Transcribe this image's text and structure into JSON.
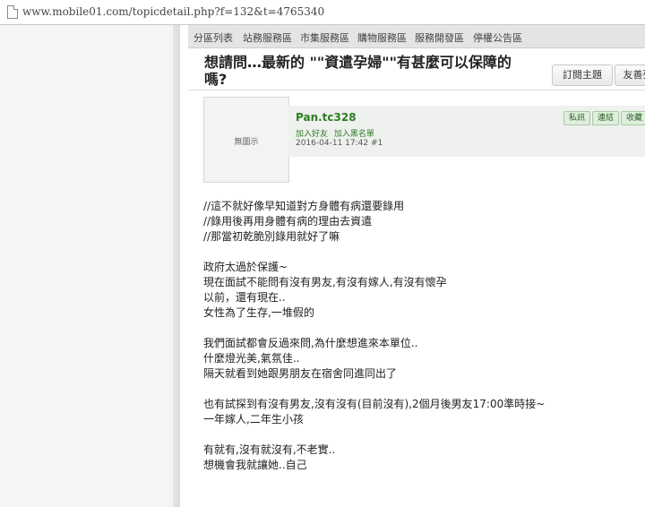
{
  "browser": {
    "url": "www.mobile01.com/topicdetail.php?f=132&t=4765340"
  },
  "nav": {
    "items": [
      "分區列表",
      "站務服務區",
      "市集服務區",
      "購物服務區",
      "服務開發區",
      "停權公告區"
    ]
  },
  "topic": {
    "title_line1": "想請問…最新的 \"\"資遣孕婦\"\"有甚麼可以保障的",
    "title_line2": "嗎?"
  },
  "tabs": {
    "subscribe": "訂閱主題",
    "friendly": "友善列"
  },
  "post": {
    "avatar_text": "無圖示",
    "user_name": "Pan.tc328",
    "add_friend": "加入好友",
    "add_blacklist": "加入黑名單",
    "meta": "2016-04-11 17:42  #1",
    "actions": [
      "私訊",
      "連結",
      "收藏"
    ],
    "lines": [
      "//這不就好像早知道對方身體有病還要錄用",
      "//錄用後再用身體有病的理由去資遣",
      "//那當初乾脆別錄用就好了嘛",
      "",
      "政府太過於保護~",
      "現在面試不能問有沒有男友,有沒有嫁人,有沒有懷孕",
      "以前，還有現在..",
      "女性為了生存,一堆假的",
      "",
      "我們面試都會反過來問,為什麼想進來本單位..",
      "什麼燈光美,氣氛佳..",
      "隔天就看到她跟男朋友在宿舍同進同出了",
      "",
      "也有試探到有沒有男友,沒有沒有(目前沒有),2個月後男友17:00準時接~",
      "一年嫁人,二年生小孩",
      "",
      "有就有,沒有就沒有,不老實..",
      "想機會我就讓她..自己"
    ]
  }
}
